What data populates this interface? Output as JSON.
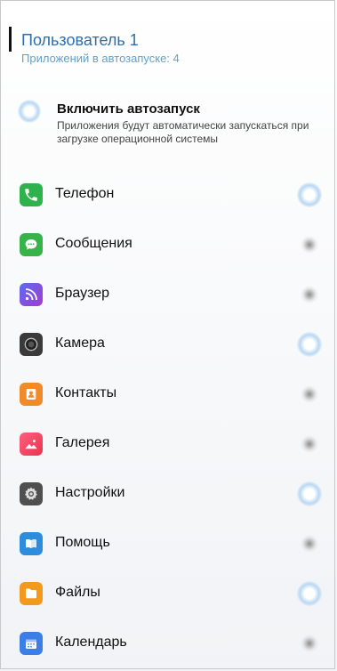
{
  "user": {
    "title": "Пользователь 1",
    "subtitle": "Приложений в автозапуске: 4"
  },
  "autostart": {
    "title": "Включить автозапуск",
    "description": "Приложения будут автоматически запускаться при загрузке операционной системы",
    "enabled": true
  },
  "apps": [
    {
      "label": "Телефон",
      "icon": "phone-icon",
      "color": "#2fb24c",
      "enabled": true
    },
    {
      "label": "Сообщения",
      "icon": "messages-icon",
      "color": "#37b349",
      "enabled": false
    },
    {
      "label": "Браузер",
      "icon": "browser-icon",
      "color": "#7b4cd6",
      "enabled": false
    },
    {
      "label": "Камера",
      "icon": "camera-icon",
      "color": "#4a4a4a",
      "enabled": true
    },
    {
      "label": "Контакты",
      "icon": "contacts-icon",
      "color": "#f08a2a",
      "enabled": false
    },
    {
      "label": "Галерея",
      "icon": "gallery-icon",
      "color": "#ef3e5c",
      "enabled": false
    },
    {
      "label": "Настройки",
      "icon": "settings-icon",
      "color": "#555555",
      "enabled": true
    },
    {
      "label": "Помощь",
      "icon": "help-icon",
      "color": "#2d8ddc",
      "enabled": false
    },
    {
      "label": "Файлы",
      "icon": "files-icon",
      "color": "#f39a1e",
      "enabled": true
    },
    {
      "label": "Календарь",
      "icon": "calendar-icon",
      "color": "#3b7fe6",
      "enabled": false
    }
  ]
}
